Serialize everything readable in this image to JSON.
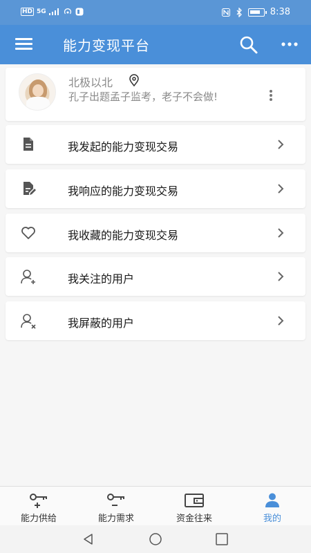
{
  "status_bar": {
    "signal_label": "HD",
    "network": "5G",
    "time": "8:38"
  },
  "app_bar": {
    "title": "能力变现平台",
    "menu_icon": "hamburger-menu-icon",
    "search_icon": "search-icon",
    "more_icon": "more-horizontal-icon"
  },
  "profile": {
    "name": "北极以北",
    "bio": "孔子出题孟子监考，老子不会做!",
    "location_icon": "location-pin-icon",
    "options_icon": "more-vertical-icon"
  },
  "menu_items": [
    {
      "label": "我发起的能力变现交易",
      "icon": "document-icon"
    },
    {
      "label": "我响应的能力变现交易",
      "icon": "document-edit-icon"
    },
    {
      "label": "我收藏的能力变现交易",
      "icon": "heart-icon"
    },
    {
      "label": "我关注的用户",
      "icon": "user-add-icon"
    },
    {
      "label": "我屏蔽的用户",
      "icon": "user-block-icon"
    }
  ],
  "bottom_nav": [
    {
      "label": "能力供给",
      "icon": "key-plus-icon"
    },
    {
      "label": "能力需求",
      "icon": "key-minus-icon"
    },
    {
      "label": "资金往来",
      "icon": "wallet-icon"
    },
    {
      "label": "我的",
      "icon": "person-icon",
      "active": true
    }
  ],
  "colors": {
    "primary": "#4a8fd9",
    "status_bar": "#5a96d6",
    "background": "#f6f6f6",
    "active_tab": "#4a8fd9"
  }
}
